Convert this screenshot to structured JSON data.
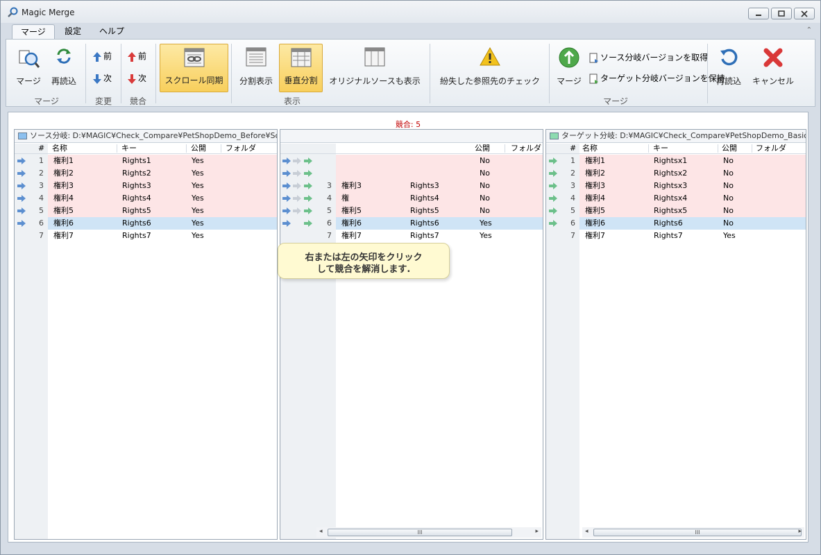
{
  "window": {
    "title": "Magic Merge"
  },
  "menu": {
    "tabs": [
      "マージ",
      "設定",
      "ヘルプ"
    ]
  },
  "ribbon": {
    "merge_group": {
      "label": "マージ",
      "merge": "マージ",
      "reload": "再読込"
    },
    "change_group": {
      "label": "変更",
      "prev": "前",
      "next": "次"
    },
    "conflict_group": {
      "label": "競合",
      "prev": "前",
      "next": "次"
    },
    "display_group": {
      "label": "表示",
      "scroll_sync": "スクロール同期",
      "split_view": "分割表示",
      "vertical_split": "垂直分割",
      "show_original": "オリジナルソースも表示"
    },
    "check_missing": "紛失した参照先のチェック",
    "merge_group2": {
      "label": "マージ",
      "merge": "マージ",
      "get_source": "ソース分岐バージョンを取得",
      "keep_target": "ターゲット分岐バージョンを保持",
      "reload": "再読込",
      "cancel": "キャンセル"
    }
  },
  "conflict_count": "競合: 5",
  "tooltip": {
    "line1": "右または左の矢印をクリック",
    "line2": "して競合を解消します."
  },
  "columns": {
    "num": "#",
    "name": "名称",
    "key": "キー",
    "public": "公開",
    "folder": "フォルダ"
  },
  "left_panel": {
    "header": "ソース分岐:  D:¥MAGIC¥Check_Compare¥PetShopDemo_Before¥Source¥",
    "rows": [
      {
        "n": "1",
        "name": "権利1",
        "key": "Rights1",
        "pub": "Yes"
      },
      {
        "n": "2",
        "name": "権利2",
        "key": "Rights2",
        "pub": "Yes"
      },
      {
        "n": "3",
        "name": "権利3",
        "key": "Rights3",
        "pub": "Yes"
      },
      {
        "n": "4",
        "name": "権利4",
        "key": "Rights4",
        "pub": "Yes"
      },
      {
        "n": "5",
        "name": "権利5",
        "key": "Rights5",
        "pub": "Yes"
      },
      {
        "n": "6",
        "name": "権利6",
        "key": "Rights6",
        "pub": "Yes"
      },
      {
        "n": "7",
        "name": "権利7",
        "key": "Rights7",
        "pub": "Yes"
      }
    ]
  },
  "middle_panel": {
    "rows": [
      {
        "n": "",
        "name": "",
        "key": "",
        "pub": "No"
      },
      {
        "n": "",
        "name": "",
        "key": "",
        "pub": "No"
      },
      {
        "n": "3",
        "name": "権利3",
        "key": "Rights3",
        "pub": "No"
      },
      {
        "n": "4",
        "name": "権",
        "key": "Rights4",
        "pub": "No"
      },
      {
        "n": "5",
        "name": "権利5",
        "key": "Rights5",
        "pub": "No"
      },
      {
        "n": "6",
        "name": "権利6",
        "key": "Rights6",
        "pub": "Yes"
      },
      {
        "n": "7",
        "name": "権利7",
        "key": "Rights7",
        "pub": "Yes"
      }
    ]
  },
  "right_panel": {
    "header": "ターゲット分岐:  D:¥MAGIC¥Check_Compare¥PetShopDemo_Basic¥Source¥",
    "rows": [
      {
        "n": "1",
        "name": "権利1",
        "key": "Rightsx1",
        "pub": "No"
      },
      {
        "n": "2",
        "name": "権利2",
        "key": "Rightsx2",
        "pub": "No"
      },
      {
        "n": "3",
        "name": "権利3",
        "key": "Rightsx3",
        "pub": "No"
      },
      {
        "n": "4",
        "name": "権利4",
        "key": "Rightsx4",
        "pub": "No"
      },
      {
        "n": "5",
        "name": "権利5",
        "key": "Rightsx5",
        "pub": "No"
      },
      {
        "n": "6",
        "name": "権利6",
        "key": "Rights6",
        "pub": "No"
      },
      {
        "n": "7",
        "name": "権利7",
        "key": "Rights7",
        "pub": "Yes"
      }
    ]
  },
  "scroll_thumb": "III",
  "colors": {
    "conflict_row": "#fde5e6",
    "selected_row": "#cfe4f6",
    "accent_button": "#f8cf5c",
    "conflict_text": "#c00000"
  }
}
